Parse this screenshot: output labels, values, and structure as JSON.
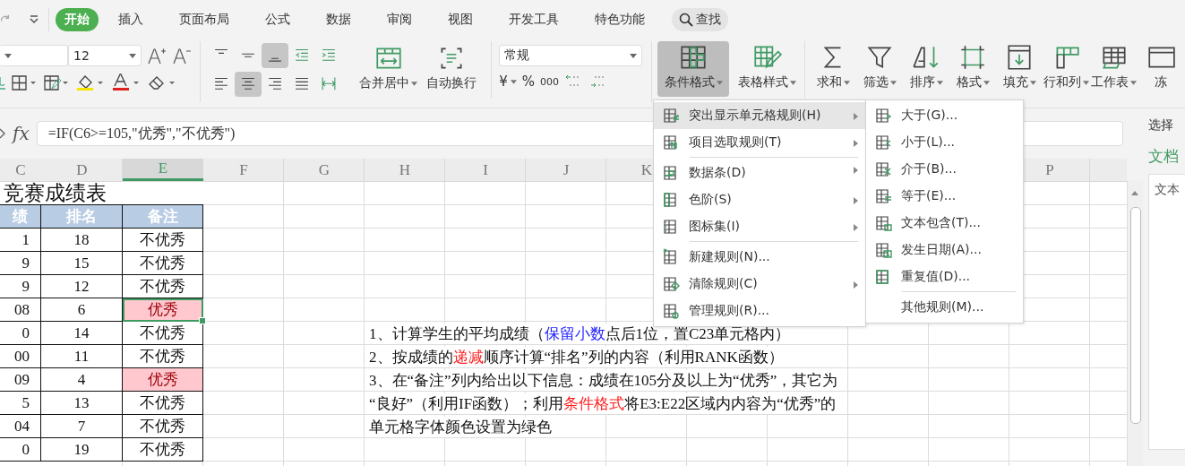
{
  "tabs": [
    {
      "label": "开始",
      "selected": true
    },
    {
      "label": "插入",
      "selected": false
    },
    {
      "label": "页面布局",
      "selected": false
    },
    {
      "label": "公式",
      "selected": false
    },
    {
      "label": "数据",
      "selected": false
    },
    {
      "label": "审阅",
      "selected": false
    },
    {
      "label": "视图",
      "selected": false
    },
    {
      "label": "开发工具",
      "selected": false
    },
    {
      "label": "特色功能",
      "selected": false
    }
  ],
  "search": {
    "label": "查找"
  },
  "font": {
    "size": "12"
  },
  "align_buttons": [
    {
      "kind": "top",
      "pressed": false
    },
    {
      "kind": "middle",
      "pressed": false
    },
    {
      "kind": "bottom",
      "pressed": true
    },
    {
      "kind": "outdent",
      "pressed": false
    },
    {
      "kind": "indent",
      "pressed": false
    },
    {
      "kind": "left",
      "pressed": false
    },
    {
      "kind": "center",
      "pressed": true
    },
    {
      "kind": "right",
      "pressed": false
    },
    {
      "kind": "justify",
      "pressed": false
    },
    {
      "kind": "distributed",
      "pressed": false
    }
  ],
  "merge_buttons": [
    {
      "label": "合并居中",
      "kind": "merge",
      "dropdown": true
    },
    {
      "label": "自动换行",
      "kind": "wrap",
      "dropdown": false
    }
  ],
  "number_format": {
    "value": "常规"
  },
  "number_buttons": [
    {
      "label": "¥",
      "dropdown": true
    },
    {
      "label": "%",
      "dropdown": false
    },
    {
      "label": "000",
      "dropdown": false
    }
  ],
  "style_buttons": [
    {
      "label": "条件格式",
      "kind": "conditional",
      "pressed": true
    },
    {
      "label": "表格样式",
      "kind": "table-style",
      "pressed": false
    }
  ],
  "tool_buttons": [
    {
      "label": "求和",
      "kind": "sum"
    },
    {
      "label": "筛选",
      "kind": "filter"
    },
    {
      "label": "排序",
      "kind": "sort"
    },
    {
      "label": "格式",
      "kind": "format"
    },
    {
      "label": "填充",
      "kind": "fill"
    },
    {
      "label": "行和列",
      "kind": "rowcol"
    },
    {
      "label": "工作表",
      "kind": "sheet"
    },
    {
      "label": "冻",
      "kind": "freeze"
    }
  ],
  "formula_bar": {
    "label": "fx",
    "formula": "=IF(C6>=105,\"优秀\",\"不优秀\")"
  },
  "columns": [
    {
      "label": "C",
      "selected": false
    },
    {
      "label": "D",
      "selected": false
    },
    {
      "label": "E",
      "selected": true
    },
    {
      "label": "F",
      "selected": false
    },
    {
      "label": "G",
      "selected": false
    },
    {
      "label": "H",
      "selected": false
    },
    {
      "label": "I",
      "selected": false
    },
    {
      "label": "J",
      "selected": false
    },
    {
      "label": "K",
      "selected": false
    },
    {
      "label": "P",
      "selected": false
    }
  ],
  "sheet": {
    "title": "竞赛成绩表",
    "headers": [
      "绩",
      "排名",
      "备注"
    ],
    "rows": [
      {
        "score": "1",
        "rank": "18",
        "note": "不优秀",
        "highlighted": false,
        "selected": false
      },
      {
        "score": "9",
        "rank": "15",
        "note": "不优秀",
        "highlighted": false,
        "selected": false
      },
      {
        "score": "9",
        "rank": "12",
        "note": "不优秀",
        "highlighted": false,
        "selected": false
      },
      {
        "score": "08",
        "rank": "6",
        "note": "优秀",
        "highlighted": true,
        "selected": true
      },
      {
        "score": "0",
        "rank": "14",
        "note": "不优秀",
        "highlighted": false,
        "selected": false
      },
      {
        "score": "00",
        "rank": "11",
        "note": "不优秀",
        "highlighted": false,
        "selected": false
      },
      {
        "score": "09",
        "rank": "4",
        "note": "优秀",
        "highlighted": true,
        "selected": false
      },
      {
        "score": "5",
        "rank": "13",
        "note": "不优秀",
        "highlighted": false,
        "selected": false
      },
      {
        "score": "04",
        "rank": "7",
        "note": "不优秀",
        "highlighted": false,
        "selected": false
      },
      {
        "score": "0",
        "rank": "19",
        "note": "不优秀",
        "highlighted": false,
        "selected": false
      }
    ]
  },
  "notes": [
    [
      {
        "text": "1、计算学生的平均成绩（"
      },
      {
        "text": "保留小数",
        "color": "#1f1fff"
      },
      {
        "text": "点后1位，置C23单元格内）"
      }
    ],
    [
      {
        "text": "2、按成绩的"
      },
      {
        "text": "递减",
        "color": "#ff2020"
      },
      {
        "text": "顺序计算“排名”列的内容（利用RANK函数）"
      }
    ],
    [
      {
        "text": "3、在“备注”列内给出以下信息：成绩在105分及以上为“优秀”，其它为"
      }
    ],
    [
      {
        "text": "“良好”（利用IF函数）；利用"
      },
      {
        "text": "条件格式",
        "color": "#ff2020"
      },
      {
        "text": "将E3:E22区域内内容为“优秀”的"
      }
    ],
    [
      {
        "text": "单元格字体颜色设置为绿色"
      }
    ]
  ],
  "cf_menu": [
    {
      "label": "突出显示单元格规则(H)",
      "kind": "highlight",
      "submenu": true,
      "selected": true,
      "separator_before": false
    },
    {
      "label": "项目选取规则(T)",
      "kind": "top10",
      "submenu": true,
      "selected": false,
      "separator_before": false
    },
    {
      "label": "数据条(D)",
      "kind": "databar",
      "submenu": true,
      "selected": false,
      "separator_before": true
    },
    {
      "label": "色阶(S)",
      "kind": "colorscale",
      "submenu": true,
      "selected": false,
      "separator_before": false
    },
    {
      "label": "图标集(I)",
      "kind": "iconset",
      "submenu": true,
      "selected": false,
      "separator_before": false
    },
    {
      "label": "新建规则(N)...",
      "kind": "new",
      "submenu": false,
      "selected": false,
      "separator_before": true
    },
    {
      "label": "清除规则(C)",
      "kind": "clear",
      "submenu": true,
      "selected": false,
      "separator_before": false
    },
    {
      "label": "管理规则(R)...",
      "kind": "manage",
      "submenu": false,
      "selected": false,
      "separator_before": false
    }
  ],
  "submenu": [
    {
      "label": "大于(G)...",
      "kind": "greater",
      "separator_before": false
    },
    {
      "label": "小于(L)...",
      "kind": "less",
      "separator_before": false
    },
    {
      "label": "介于(B)...",
      "kind": "between",
      "separator_before": false
    },
    {
      "label": "等于(E)...",
      "kind": "equal",
      "separator_before": false
    },
    {
      "label": "文本包含(T)...",
      "kind": "text",
      "separator_before": false
    },
    {
      "label": "发生日期(A)...",
      "kind": "date",
      "separator_before": false
    },
    {
      "label": "重复值(D)...",
      "kind": "duplicate",
      "separator_before": false
    },
    {
      "label": "其他规则(M)...",
      "kind": "other",
      "separator_before": true
    }
  ],
  "task_pane": {
    "title": "选择",
    "section": "文档",
    "field": "文本"
  }
}
